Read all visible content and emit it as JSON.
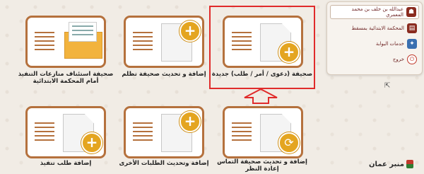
{
  "sidebar": {
    "user_name": "عبدالله بن خلف بن محمد المعمري",
    "court": "المحكمة الابتدائية بمسقط",
    "services": "خدمات البوابة",
    "logout": "خروج"
  },
  "tiles": {
    "new_sheet": "صحيفة (دعوى / أمر / طلب) جديدة",
    "grievance": "إضافة و تحديث صحيفة تظلم",
    "appeal_exec": "صحيفة استئناف منازعات التنفيذ أمام المحكمة الابتدائية",
    "reconsider": "إضافة و تحديث صحيفة التماس إعادة النظر",
    "other_requests": "إضافة وتحديث الطلبات الأخرى",
    "exec_request": "إضافة طلب تنفيذ"
  },
  "watermark": "منبر عمان",
  "colors": {
    "tile_border": "#b5713d",
    "accent": "#e4a520",
    "highlight": "#e02b2b"
  }
}
